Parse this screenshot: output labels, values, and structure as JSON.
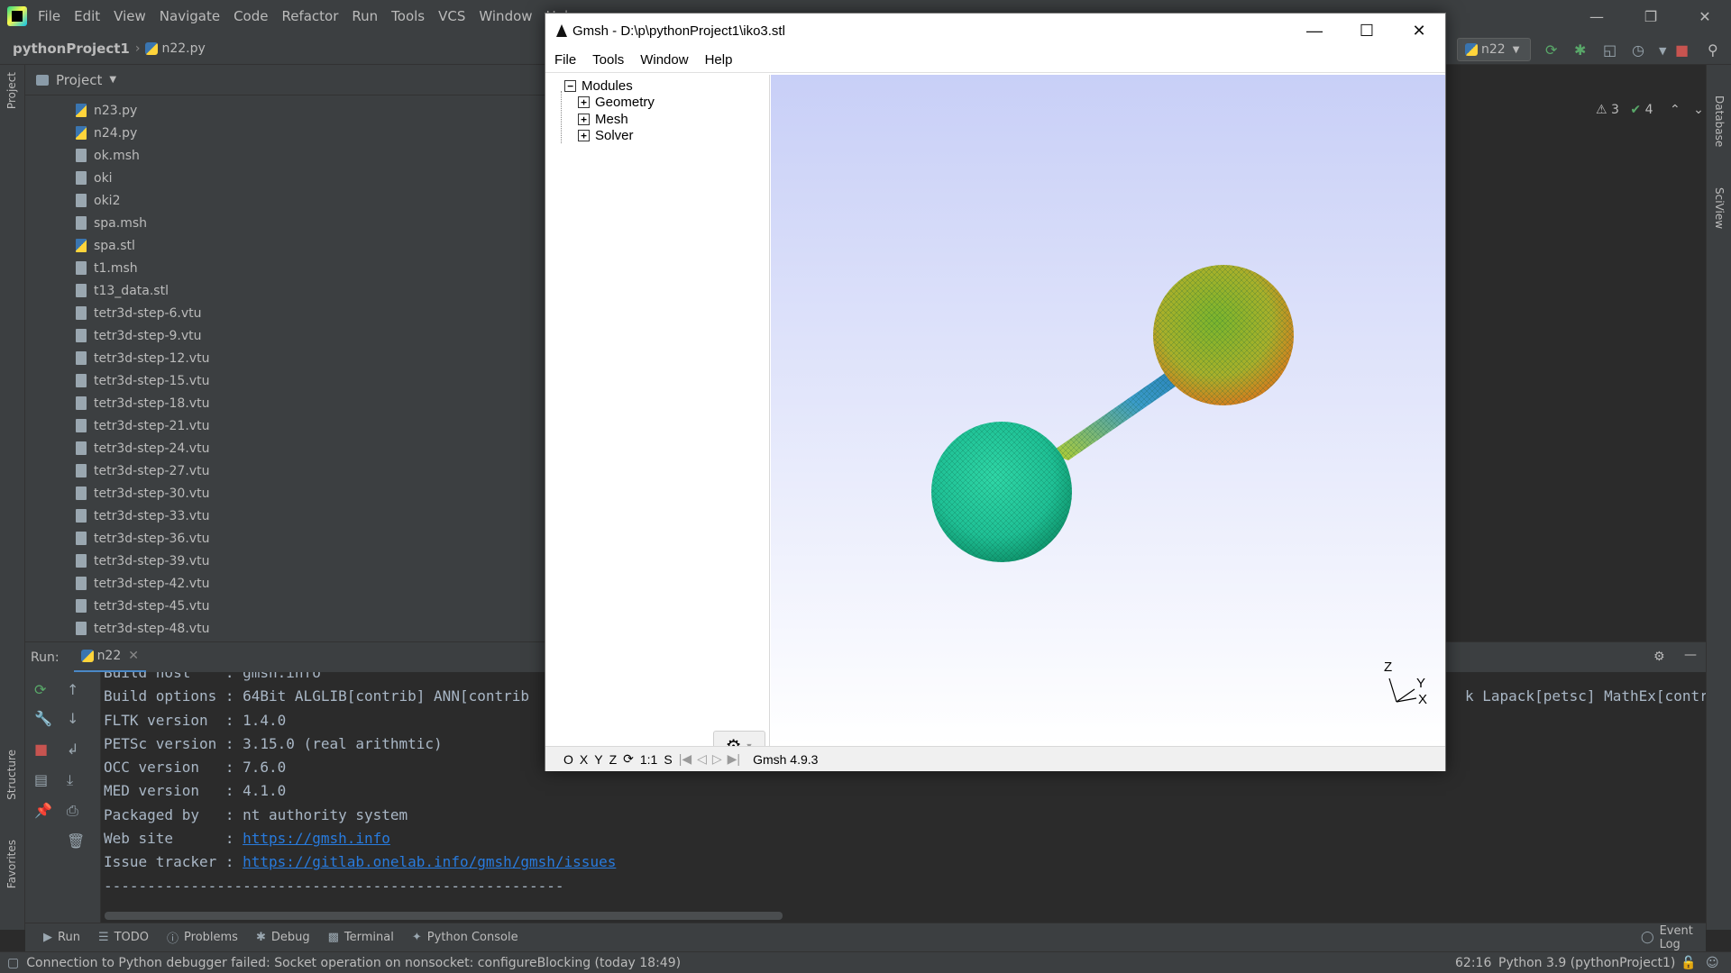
{
  "pycharm": {
    "menu": [
      "File",
      "Edit",
      "View",
      "Navigate",
      "Code",
      "Refactor",
      "Run",
      "Tools",
      "VCS",
      "Window",
      "Help"
    ],
    "project_name": "pythonProject1",
    "current_file": "n22.py",
    "run_config": "n22",
    "project_panel_title": "Project",
    "files": [
      {
        "name": "n23.py",
        "type": "py"
      },
      {
        "name": "n24.py",
        "type": "py"
      },
      {
        "name": "ok.msh",
        "type": "file"
      },
      {
        "name": "oki",
        "type": "file"
      },
      {
        "name": "oki2",
        "type": "file"
      },
      {
        "name": "spa.msh",
        "type": "file"
      },
      {
        "name": "spa.stl",
        "type": "py"
      },
      {
        "name": "t1.msh",
        "type": "file"
      },
      {
        "name": "t13_data.stl",
        "type": "file"
      },
      {
        "name": "tetr3d-step-6.vtu",
        "type": "file"
      },
      {
        "name": "tetr3d-step-9.vtu",
        "type": "file"
      },
      {
        "name": "tetr3d-step-12.vtu",
        "type": "file"
      },
      {
        "name": "tetr3d-step-15.vtu",
        "type": "file"
      },
      {
        "name": "tetr3d-step-18.vtu",
        "type": "file"
      },
      {
        "name": "tetr3d-step-21.vtu",
        "type": "file"
      },
      {
        "name": "tetr3d-step-24.vtu",
        "type": "file"
      },
      {
        "name": "tetr3d-step-27.vtu",
        "type": "file"
      },
      {
        "name": "tetr3d-step-30.vtu",
        "type": "file"
      },
      {
        "name": "tetr3d-step-33.vtu",
        "type": "file"
      },
      {
        "name": "tetr3d-step-36.vtu",
        "type": "file"
      },
      {
        "name": "tetr3d-step-39.vtu",
        "type": "file"
      },
      {
        "name": "tetr3d-step-42.vtu",
        "type": "file"
      },
      {
        "name": "tetr3d-step-45.vtu",
        "type": "file"
      },
      {
        "name": "tetr3d-step-48.vtu",
        "type": "file"
      }
    ],
    "inspections": {
      "warnings": "3",
      "ok": "4"
    },
    "left_tabs": [
      "Project",
      "Structure",
      "Favorites"
    ],
    "right_tabs": [
      "Database",
      "SciView"
    ],
    "run_label": "Run:",
    "run_tab": "n22",
    "console": [
      {
        "text": "Build host    : gmsh.info"
      },
      {
        "text": "Build options : 64Bit ALGLIB[contrib] ANN[contrib",
        "tail": "k Lapack[petsc] MathEx[contri"
      },
      {
        "text": "FLTK version  : 1.4.0"
      },
      {
        "text": "PETSc version : 3.15.0 (real arithmtic)"
      },
      {
        "text": "OCC version   : 7.6.0"
      },
      {
        "text": "MED version   : 4.1.0"
      },
      {
        "text": "Packaged by   : nt authority system"
      },
      {
        "text": "Web site      : ",
        "link": "https://gmsh.info"
      },
      {
        "text": "Issue tracker : ",
        "link": "https://gitlab.onelab.info/gmsh/gmsh/issues"
      },
      {
        "text": "-----------------------------------------------------"
      }
    ],
    "bottom_tabs": [
      "Run",
      "TODO",
      "Problems",
      "Debug",
      "Terminal",
      "Python Console"
    ],
    "event_log": "Event Log",
    "status_message": "Connection to Python debugger failed: Socket operation on nonsocket: configureBlocking (today 18:49)",
    "cursor_pos": "62:16",
    "interpreter": "Python 3.9 (pythonProject1)"
  },
  "gmsh": {
    "title": "Gmsh - D:\\p\\pythonProject1\\iko3.stl",
    "menu": [
      "File",
      "Tools",
      "Window",
      "Help"
    ],
    "tree": {
      "root": "Modules",
      "children": [
        "Geometry",
        "Mesh",
        "Solver"
      ]
    },
    "status_items": [
      "O",
      "X",
      "Y",
      "Z",
      "1:1",
      "S"
    ],
    "version": "Gmsh 4.9.3",
    "axes": {
      "z": "Z",
      "y": "Y",
      "x": "X"
    },
    "colors": {
      "sphere_top": "#b9b22a",
      "sphere_bottom": "#22c99a",
      "rod": "#2a83c5"
    }
  }
}
